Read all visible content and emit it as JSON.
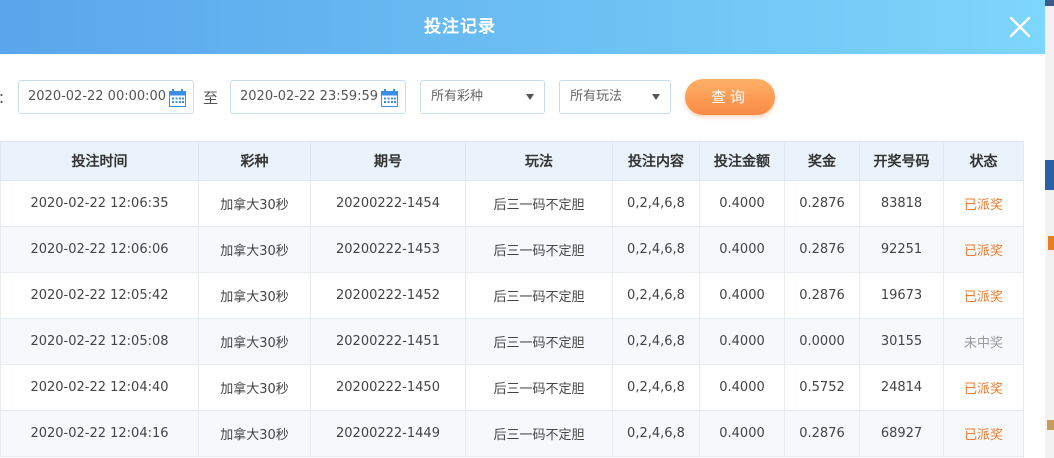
{
  "modal": {
    "title": "投注记录",
    "close_icon": "close-icon"
  },
  "filters": {
    "colon": "：",
    "start_date": "2020-02-22 00:00:00",
    "range_separator": "至",
    "end_date": "2020-02-22 23:59:59",
    "lottery_select": "所有彩种",
    "play_select": "所有玩法",
    "query_label": "查询"
  },
  "table": {
    "headers": [
      "投注时间",
      "彩种",
      "期号",
      "玩法",
      "投注内容",
      "投注金额",
      "奖金",
      "开奖号码",
      "状态"
    ],
    "rows": [
      {
        "time": "2020-02-22 12:06:35",
        "lottery": "加拿大30秒",
        "period": "20200222-1454",
        "play": "后三一码不定胆",
        "content": "0,2,4,6,8",
        "amount": "0.4000",
        "prize": "0.2876",
        "numbers": "83818",
        "status": "已派奖",
        "status_kind": "paid"
      },
      {
        "time": "2020-02-22 12:06:06",
        "lottery": "加拿大30秒",
        "period": "20200222-1453",
        "play": "后三一码不定胆",
        "content": "0,2,4,6,8",
        "amount": "0.4000",
        "prize": "0.2876",
        "numbers": "92251",
        "status": "已派奖",
        "status_kind": "paid"
      },
      {
        "time": "2020-02-22 12:05:42",
        "lottery": "加拿大30秒",
        "period": "20200222-1452",
        "play": "后三一码不定胆",
        "content": "0,2,4,6,8",
        "amount": "0.4000",
        "prize": "0.2876",
        "numbers": "19673",
        "status": "已派奖",
        "status_kind": "paid"
      },
      {
        "time": "2020-02-22 12:05:08",
        "lottery": "加拿大30秒",
        "period": "20200222-1451",
        "play": "后三一码不定胆",
        "content": "0,2,4,6,8",
        "amount": "0.4000",
        "prize": "0.0000",
        "numbers": "30155",
        "status": "未中奖",
        "status_kind": "none"
      },
      {
        "time": "2020-02-22 12:04:40",
        "lottery": "加拿大30秒",
        "period": "20200222-1450",
        "play": "后三一码不定胆",
        "content": "0,2,4,6,8",
        "amount": "0.4000",
        "prize": "0.5752",
        "numbers": "24814",
        "status": "已派奖",
        "status_kind": "paid"
      },
      {
        "time": "2020-02-22 12:04:16",
        "lottery": "加拿大30秒",
        "period": "20200222-1449",
        "play": "后三一码不定胆",
        "content": "0,2,4,6,8",
        "amount": "0.4000",
        "prize": "0.2876",
        "numbers": "68927",
        "status": "已派奖",
        "status_kind": "paid"
      }
    ]
  },
  "colors": {
    "header_gradient_start": "#5aa5ec",
    "header_gradient_end": "#7dd6fb",
    "status_paid": "#ee7a2d",
    "status_none": "#9a9a9a",
    "query_button": "#f98a45"
  }
}
